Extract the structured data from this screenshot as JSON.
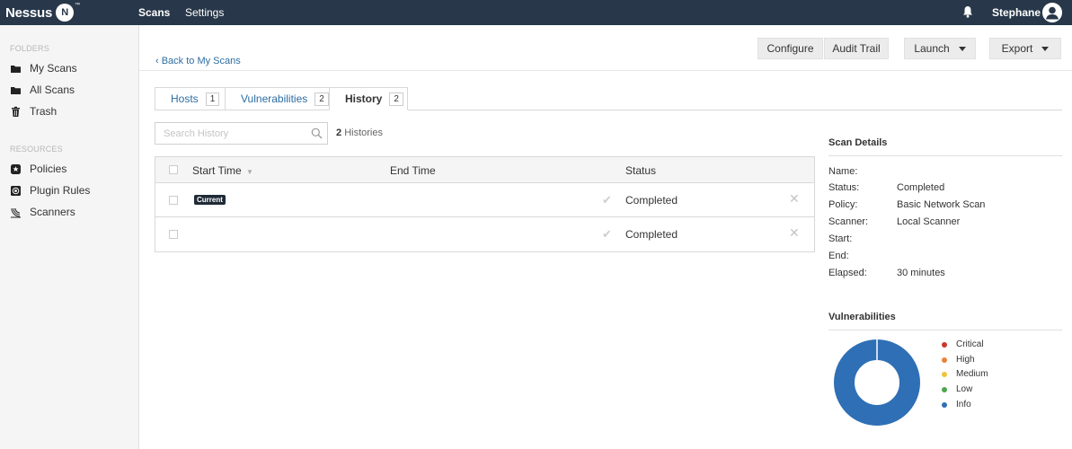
{
  "app": {
    "logo_text": "Nessus",
    "logo_badge": "N",
    "logo_tm": "™"
  },
  "topnav": {
    "scans": "Scans",
    "settings": "Settings",
    "user": "Stephane"
  },
  "sidebar": {
    "folders_heading": "FOLDERS",
    "folders": [
      {
        "label": "My Scans",
        "icon": "folder-icon"
      },
      {
        "label": "All Scans",
        "icon": "folder-icon"
      },
      {
        "label": "Trash",
        "icon": "trash-icon"
      }
    ],
    "resources_heading": "RESOURCES",
    "resources": [
      {
        "label": "Policies",
        "icon": "policy-shield-icon"
      },
      {
        "label": "Plugin Rules",
        "icon": "plugin-rules-icon"
      },
      {
        "label": "Scanners",
        "icon": "scanner-radar-icon"
      }
    ]
  },
  "main": {
    "back_link": "‹ Back to My Scans",
    "buttons": {
      "configure": "Configure",
      "audit_trail": "Audit Trail",
      "launch": "Launch",
      "export": "Export"
    },
    "tabs": [
      {
        "label": "Hosts",
        "count": "1"
      },
      {
        "label": "Vulnerabilities",
        "count": "2"
      },
      {
        "label": "History",
        "count": "2"
      }
    ],
    "search": {
      "placeholder": "Search History"
    },
    "count": {
      "number": "2",
      "label": "Histories"
    },
    "table": {
      "headers": {
        "start_time": "Start Time",
        "end_time": "End Time",
        "status": "Status"
      },
      "rows": [
        {
          "badge": "Current",
          "status": "Completed"
        },
        {
          "badge": "",
          "status": "Completed"
        }
      ]
    }
  },
  "details": {
    "title": "Scan Details",
    "fields": [
      {
        "label": "Name:",
        "value": ""
      },
      {
        "label": "Status:",
        "value": "Completed"
      },
      {
        "label": "Policy:",
        "value": "Basic Network Scan"
      },
      {
        "label": "Scanner:",
        "value": "Local Scanner"
      },
      {
        "label": "Start:",
        "value": ""
      },
      {
        "label": "End:",
        "value": ""
      },
      {
        "label": "Elapsed:",
        "value": "30 minutes"
      }
    ]
  },
  "vulnerabilities": {
    "title": "Vulnerabilities",
    "legend": [
      {
        "label": "Critical",
        "color": "#c9372c"
      },
      {
        "label": "High",
        "color": "#e8823a"
      },
      {
        "label": "Medium",
        "color": "#f0c338"
      },
      {
        "label": "Low",
        "color": "#4ca74d"
      },
      {
        "label": "Info",
        "color": "#2f6fb5"
      }
    ],
    "donut_values": {
      "critical": 0,
      "high": 0,
      "medium": 0,
      "low": 0,
      "info": 100
    }
  },
  "colors": {
    "topbar": "#28384a",
    "link": "#2d6da3",
    "info": "#2f6fb5"
  }
}
